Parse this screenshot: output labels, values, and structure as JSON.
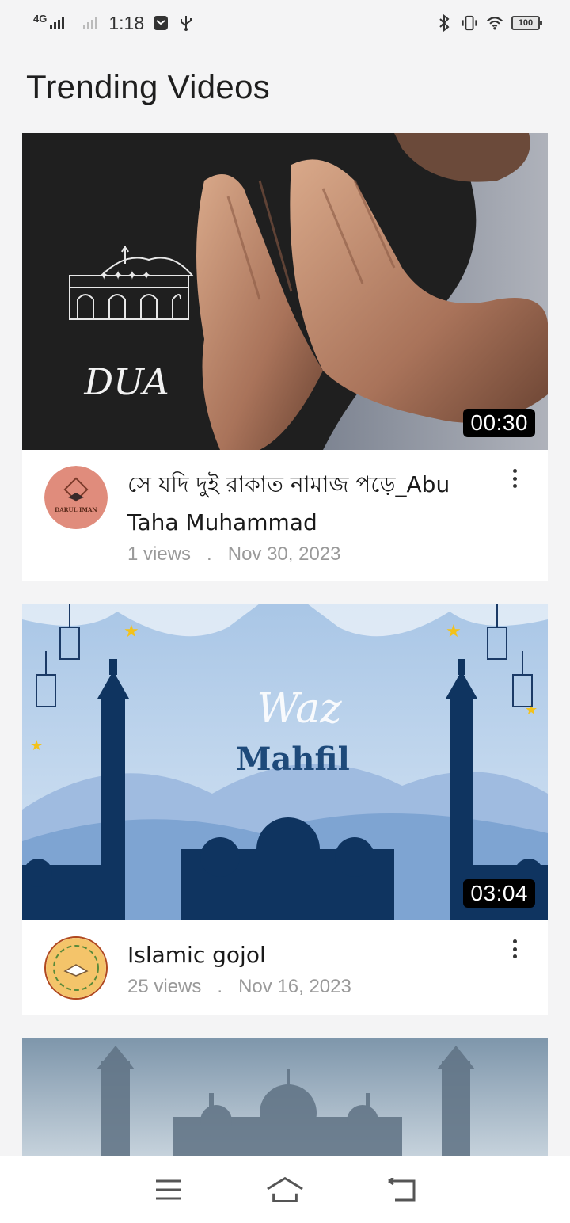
{
  "status_bar": {
    "network": "4G",
    "time": "1:18",
    "battery": "100",
    "icons": [
      "email-icon",
      "usb-icon",
      "bluetooth-icon",
      "vibrate-icon",
      "wifi-icon"
    ]
  },
  "page_title": "Trending Videos",
  "videos": [
    {
      "thumbnail_text": "DUA",
      "duration": "00:30",
      "title": "সে যদি দুই রাকাত নামাজ পড়ে_Abu Taha Muhammad",
      "views": "1 views",
      "separator": ".",
      "date": "Nov 30, 2023",
      "channel_avatar_text": "DARUL IMAN"
    },
    {
      "thumbnail_text_script": "Waz",
      "thumbnail_text": "Mahfil",
      "duration": "03:04",
      "title": "Islamic gojol",
      "views": "25 views",
      "separator": ".",
      "date": "Nov 16, 2023",
      "channel_avatar_text": ""
    }
  ],
  "colors": {
    "background": "#f4f4f5",
    "card": "#ffffff",
    "duration_badge": "#000000",
    "stats_text": "#9a9a9a"
  },
  "bottom_nav": {
    "icons": [
      "menu-icon",
      "home-icon",
      "back-icon"
    ]
  }
}
